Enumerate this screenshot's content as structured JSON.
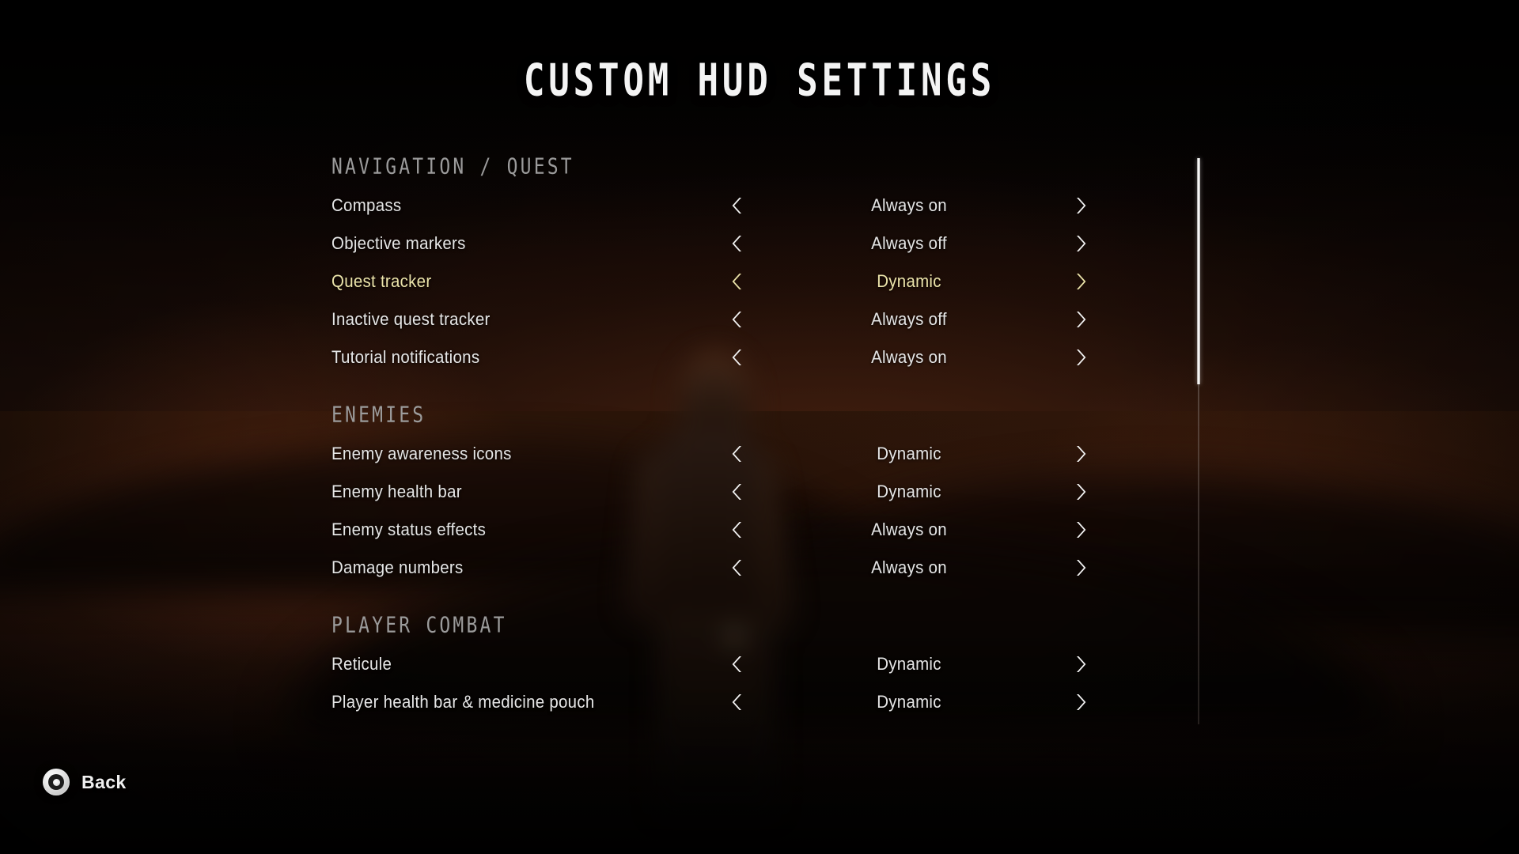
{
  "header": {
    "title": "CUSTOM HUD SETTINGS"
  },
  "colors": {
    "text": "#e6e6e6",
    "section_header": "#9b9b9b",
    "selected": "#ece4aa",
    "arrow": "#f2f2f2",
    "scroll_thumb": "#ffffff",
    "background": "#120806"
  },
  "icons": {
    "arrow_left": "chevron-left-icon",
    "arrow_right": "chevron-right-icon",
    "back_button": "circle-button-icon"
  },
  "sections": [
    {
      "title": "NAVIGATION / QUEST",
      "rows": [
        {
          "label": "Compass",
          "value": "Always on",
          "selected": false
        },
        {
          "label": "Objective markers",
          "value": "Always off",
          "selected": false
        },
        {
          "label": "Quest tracker",
          "value": "Dynamic",
          "selected": true
        },
        {
          "label": "Inactive quest tracker",
          "value": "Always off",
          "selected": false
        },
        {
          "label": "Tutorial notifications",
          "value": "Always on",
          "selected": false
        }
      ]
    },
    {
      "title": "ENEMIES",
      "rows": [
        {
          "label": "Enemy awareness icons",
          "value": "Dynamic",
          "selected": false
        },
        {
          "label": "Enemy health bar",
          "value": "Dynamic",
          "selected": false
        },
        {
          "label": "Enemy status effects",
          "value": "Always on",
          "selected": false
        },
        {
          "label": "Damage numbers",
          "value": "Always on",
          "selected": false
        }
      ]
    },
    {
      "title": "PLAYER COMBAT",
      "rows": [
        {
          "label": "Reticule",
          "value": "Dynamic",
          "selected": false
        },
        {
          "label": "Player health bar & medicine pouch",
          "value": "Dynamic",
          "selected": false
        }
      ]
    }
  ],
  "scrollbar": {
    "thumb_position_percent": 0,
    "thumb_size_percent": 40
  },
  "footer": {
    "back_label": "Back"
  }
}
